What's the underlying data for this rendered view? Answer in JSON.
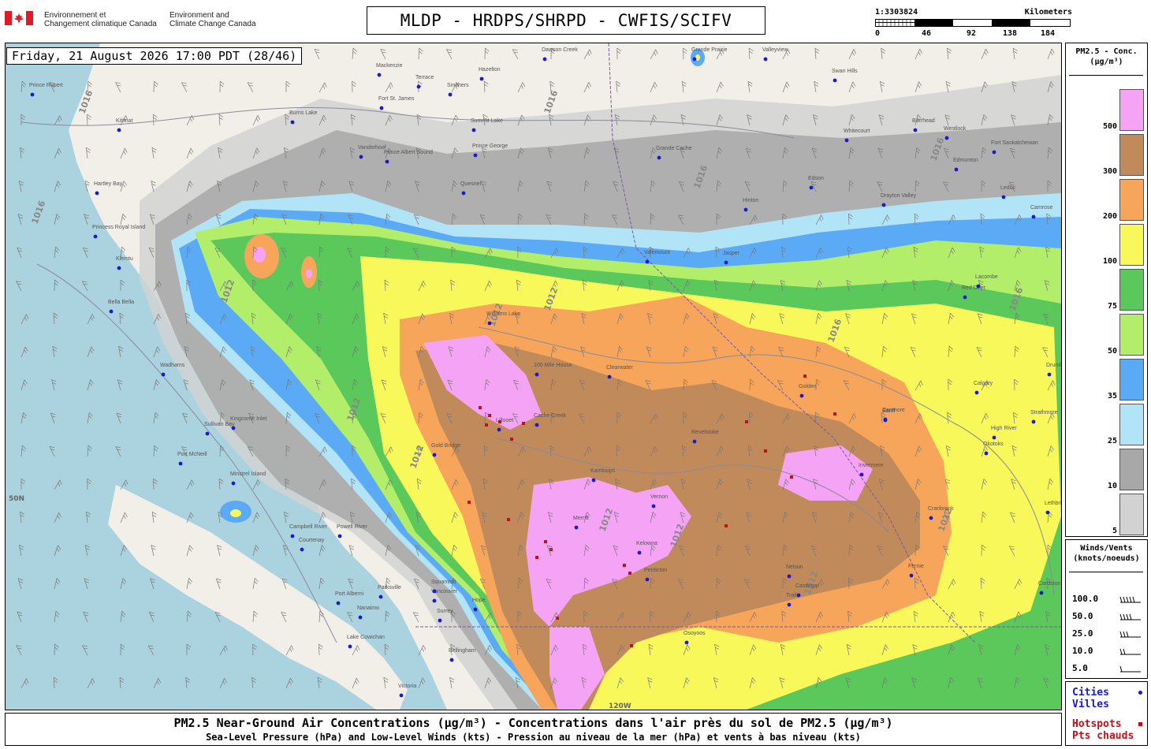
{
  "header": {
    "agency_fr_1": "Environnement et",
    "agency_fr_2": "Changement climatique Canada",
    "agency_en_1": "Environment and",
    "agency_en_2": "Climate Change Canada",
    "title": "MLDP - HRDPS/SHRPD - CWFIS/SCIFV"
  },
  "scale": {
    "ratio": "1:3303824",
    "units": "Kilometers",
    "ticks": [
      "0",
      "46",
      "92",
      "138",
      "184"
    ]
  },
  "map": {
    "datetime": "Friday, 21 August 2026 17:00 PDT (28/46)",
    "lat_label": "50N",
    "lon_label": "120W",
    "isobar_labels": [
      "1016",
      "1016",
      "1016",
      "1016",
      "1016",
      "1012",
      "1012",
      "1012",
      "1012",
      "1012",
      "1012",
      "1012",
      "1012",
      "1012",
      "1016",
      "1016"
    ],
    "places": [
      "Prince Rupert",
      "Kitimat",
      "Hartley Bay",
      "Princess Royal Island",
      "Klemtu",
      "Bella Bella",
      "Wadhams",
      "Port McNeill",
      "Sullivan Bay",
      "Kingcome Inlet",
      "Minstrel Island",
      "Campbell River",
      "Powell River",
      "Courtenay",
      "Parksville",
      "Port Alberni",
      "Nanaimo",
      "Lake Cowichan",
      "Victoria",
      "Squamish",
      "Vancouver",
      "Surrey",
      "Bellingham",
      "Vanderhoof",
      "Fort St. James",
      "Burns Lake",
      "Prince George",
      "Quesnel",
      "Williams Lake",
      "100 Mile House",
      "Cache Creek",
      "Kamloops",
      "Merritt",
      "Kelowna",
      "Vernon",
      "Penticton",
      "Revelstoke",
      "Clearwater",
      "Valemount",
      "Jasper",
      "Hinton",
      "Grande Cache",
      "Edson",
      "Edmonton",
      "Whitecourt",
      "Swan Hills",
      "Red Deer",
      "Drayton Valley",
      "Calgary",
      "Canmore",
      "Invermere",
      "Cranbrook",
      "Fernie",
      "Nelson",
      "Trail",
      "Cardston",
      "Lethbridge",
      "Valleyview",
      "Grande Prairie",
      "Dawson Creek",
      "Summit Lake",
      "Mackenzie",
      "Hazelton",
      "Terrace",
      "Smithers",
      "Prince Albert Sound",
      "Gold Bridge",
      "Lillooet",
      "Hope",
      "Osoyoos",
      "Castlegar",
      "Golden",
      "Banff",
      "High River",
      "Okotoks",
      "Strathmore",
      "Drumheller",
      "Lacombe",
      "Barrhead",
      "Westlock",
      "Fort Saskatchewan",
      "Leduc",
      "Camrose"
    ]
  },
  "legend": {
    "title_1": "PM2.5 - Conc.",
    "title_2": "(µg/m³)",
    "levels": [
      {
        "label": "500",
        "color": "#f5a3f5"
      },
      {
        "label": "300",
        "color": "#c08a5a"
      },
      {
        "label": "200",
        "color": "#f7a55a"
      },
      {
        "label": "100",
        "color": "#f8f85a"
      },
      {
        "label": "75",
        "color": "#5ac85a"
      },
      {
        "label": "50",
        "color": "#b2ee6a"
      },
      {
        "label": "35",
        "color": "#5aaaf5"
      },
      {
        "label": "25",
        "color": "#b2e4f8"
      },
      {
        "label": "10",
        "color": "#a8a8a8"
      },
      {
        "label": "5",
        "color": "#d2d2d2"
      }
    ]
  },
  "wind_legend": {
    "title_1": "Winds/Vents",
    "title_2": "(knots/noeuds)",
    "rows": [
      "100.0",
      "50.0",
      "25.0",
      "10.0",
      "5.0"
    ]
  },
  "poi_legend": {
    "cities_1": "Cities",
    "cities_2": "Villes",
    "hot_1": "Hotspots",
    "hot_2": "Pts chauds"
  },
  "caption": {
    "line1": "PM2.5 Near-Ground Air Concentrations (µg/m³) - Concentrations dans l'air près du sol de PM2.5 (µg/m³)",
    "line2": "Sea-Level Pressure (hPa) and Low-Level Winds (kts) - Pression au niveau de la mer (hPa) et vents à bas niveau (kts)"
  }
}
